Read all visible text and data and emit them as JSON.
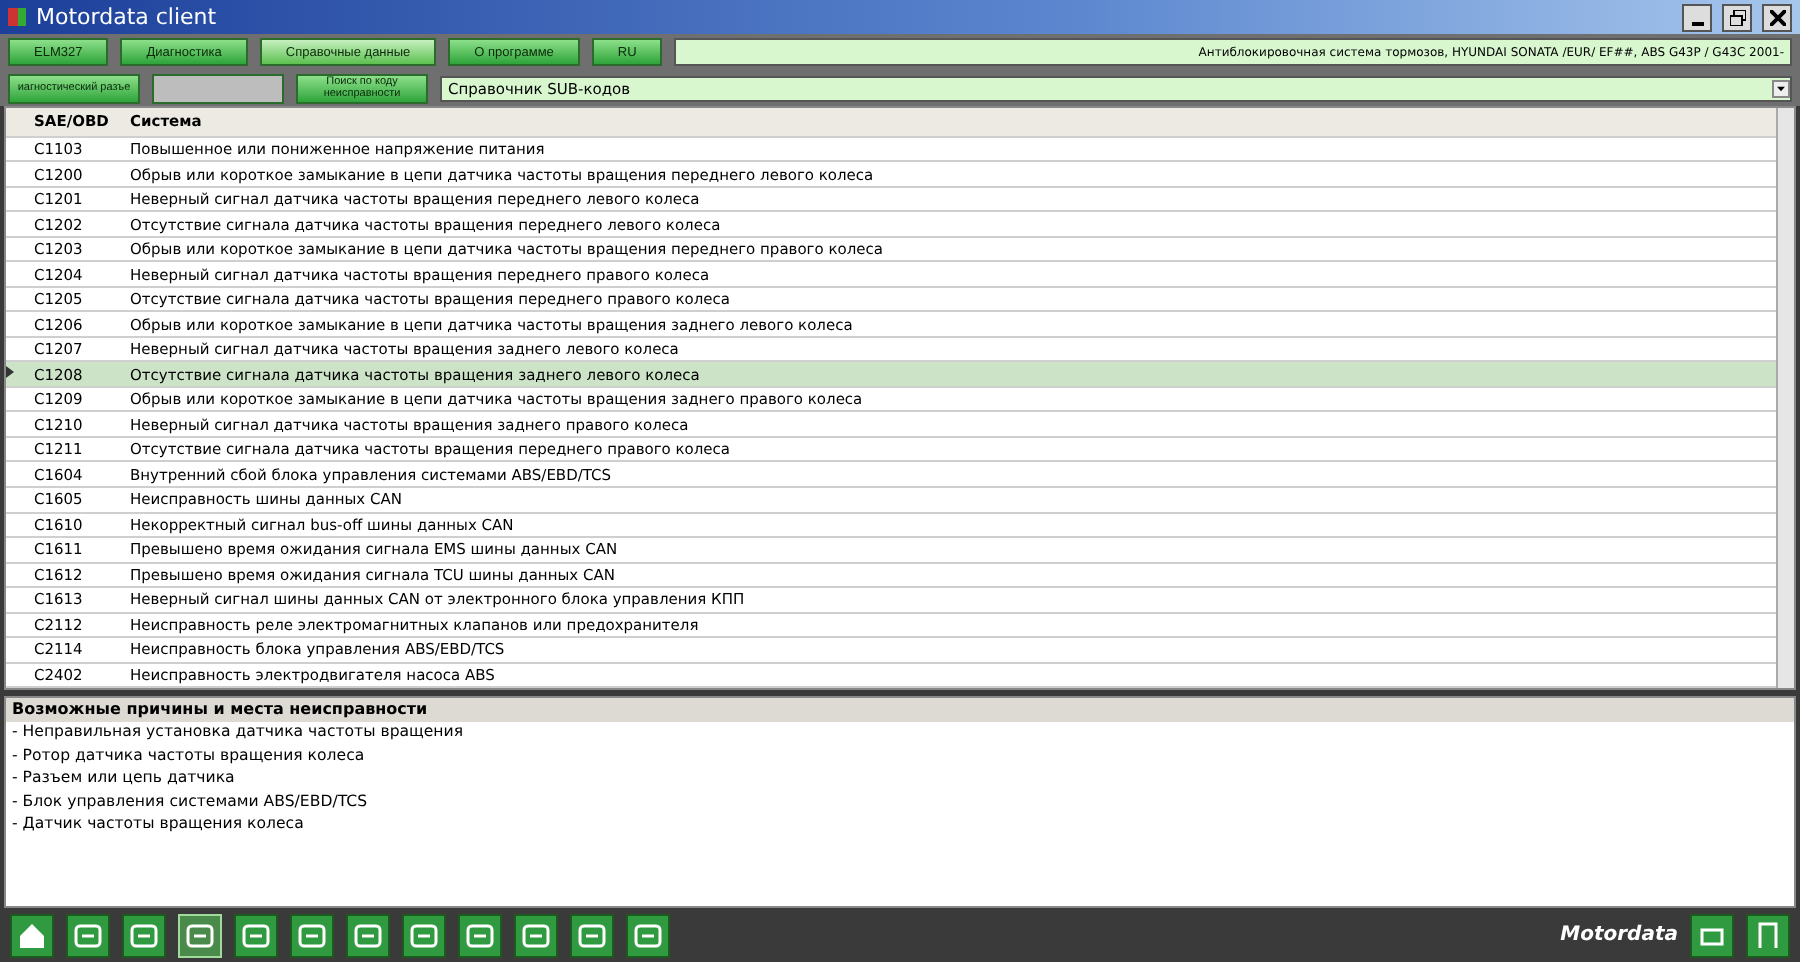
{
  "window": {
    "title": "Motordata client"
  },
  "menu": [
    {
      "label": "ELM327",
      "selected": false
    },
    {
      "label": "Диагностика",
      "selected": false
    },
    {
      "label": "Справочные данные",
      "selected": true
    },
    {
      "label": "О программе",
      "selected": false
    },
    {
      "label": "RU",
      "selected": false
    }
  ],
  "vehicle_info": "Антиблокировочная система тормозов, HYUNDAI  SONATA /EUR/  EF##,   ABS  G43P / G43C  2001-",
  "subtoolbar": [
    {
      "label": "иагностический разъе",
      "disabled": false
    },
    {
      "disabled": true
    },
    {
      "label": "Поиск по коду неисправности",
      "disabled": false
    }
  ],
  "dropdown": {
    "value": "Справочник SUB-кодов"
  },
  "table": {
    "columns": [
      "SAE/OBD",
      "Система"
    ],
    "rows": [
      {
        "code": "C1103",
        "system": "Повышенное или пониженное напряжение питания",
        "selected": false
      },
      {
        "code": "C1200",
        "system": "Обрыв или короткое замыкание в цепи датчика частоты вращения переднего левого колеса",
        "selected": false
      },
      {
        "code": "C1201",
        "system": "Неверный сигнал датчика частоты вращения переднего левого колеса",
        "selected": false
      },
      {
        "code": "C1202",
        "system": "Отсутствие сигнала датчика частоты вращения переднего левого колеса",
        "selected": false
      },
      {
        "code": "C1203",
        "system": "Обрыв или короткое замыкание в цепи датчика частоты вращения переднего правого колеса",
        "selected": false
      },
      {
        "code": "C1204",
        "system": "Неверный сигнал датчика частоты вращения переднего правого колеса",
        "selected": false
      },
      {
        "code": "C1205",
        "system": "Отсутствие сигнала датчика частоты вращения переднего правого колеса",
        "selected": false
      },
      {
        "code": "C1206",
        "system": "Обрыв или короткое замыкание в цепи датчика частоты вращения заднего левого колеса",
        "selected": false
      },
      {
        "code": "C1207",
        "system": "Неверный сигнал датчика частоты вращения заднего левого колеса",
        "selected": false
      },
      {
        "code": "C1208",
        "system": "Отсутствие сигнала датчика частоты вращения заднего левого колеса",
        "selected": true
      },
      {
        "code": "C1209",
        "system": "Обрыв или короткое замыкание в цепи датчика частоты вращения заднего правого колеса",
        "selected": false
      },
      {
        "code": "C1210",
        "system": "Неверный сигнал датчика частоты вращения заднего правого колеса",
        "selected": false
      },
      {
        "code": "C1211",
        "system": "Отсутствие сигнала датчика частоты вращения переднего правого колеса",
        "selected": false
      },
      {
        "code": "C1604",
        "system": "Внутренний сбой блока управления системами ABS/EBD/TCS",
        "selected": false
      },
      {
        "code": "C1605",
        "system": "Неисправность шины данных CAN",
        "selected": false
      },
      {
        "code": "C1610",
        "system": "Некорректный сигнал bus-off шины данных CAN",
        "selected": false
      },
      {
        "code": "C1611",
        "system": "Превышено время ожидания сигнала EMS шины данных CAN",
        "selected": false
      },
      {
        "code": "C1612",
        "system": "Превышено время ожидания сигнала TCU шины данных CAN",
        "selected": false
      },
      {
        "code": "C1613",
        "system": "Неверный сигнал шины данных CAN от электронного блока управления КПП",
        "selected": false
      },
      {
        "code": "C2112",
        "system": "Неисправность реле электромагнитных клапанов или предохранителя",
        "selected": false
      },
      {
        "code": "C2114",
        "system": "Неисправность блока управления ABS/EBD/TCS",
        "selected": false
      },
      {
        "code": "C2402",
        "system": "Неисправность электродвигателя насоса ABS",
        "selected": false
      }
    ]
  },
  "details": {
    "title": "Возможные причины и места неисправности",
    "lines": [
      "- Неправильная установка датчика частоты вращения",
      "- Ротор датчика частоты вращения колеса",
      "- Разъем или цепь датчика",
      "- Блок управления системами ABS/EBD/TCS",
      "- Датчик частоты вращения колеса"
    ]
  },
  "bottom_toolbar": {
    "buttons": [
      {
        "selected": false
      },
      {
        "selected": false
      },
      {
        "selected": false
      },
      {
        "selected": true
      },
      {
        "selected": false
      },
      {
        "selected": false
      },
      {
        "selected": false
      },
      {
        "selected": false
      },
      {
        "selected": false
      },
      {
        "selected": false
      },
      {
        "selected": false
      },
      {
        "selected": false
      }
    ],
    "logo": "Motordata"
  }
}
